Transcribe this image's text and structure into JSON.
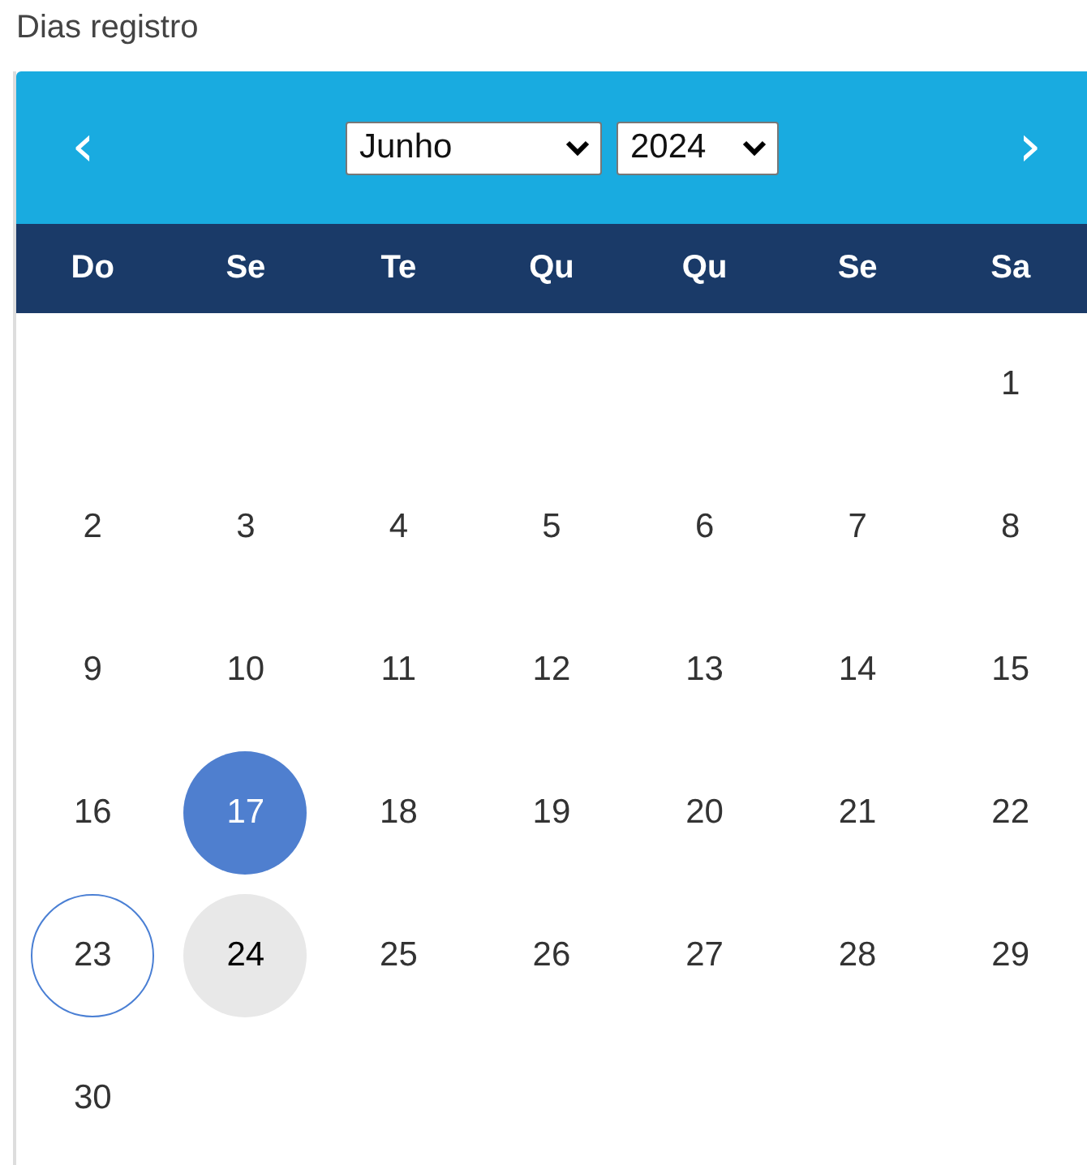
{
  "label": "Dias registro",
  "header": {
    "prev": "‹",
    "next": "›",
    "month": "Junho",
    "year": "2024"
  },
  "weekdays": [
    "Do",
    "Se",
    "Te",
    "Qu",
    "Qu",
    "Se",
    "Sa"
  ],
  "weeks": [
    {
      "days": [
        {
          "day": "1",
          "selected": false,
          "today": false,
          "highlighted": false
        }
      ]
    },
    {
      "days": [
        {
          "day": "2",
          "selected": false,
          "today": false,
          "highlighted": false
        },
        {
          "day": "3",
          "selected": false,
          "today": false,
          "highlighted": false
        },
        {
          "day": "4",
          "selected": false,
          "today": false,
          "highlighted": false
        },
        {
          "day": "5",
          "selected": false,
          "today": false,
          "highlighted": false
        },
        {
          "day": "6",
          "selected": false,
          "today": false,
          "highlighted": false
        },
        {
          "day": "7",
          "selected": false,
          "today": false,
          "highlighted": false
        },
        {
          "day": "8",
          "selected": false,
          "today": false,
          "highlighted": false
        }
      ]
    },
    {
      "days": [
        {
          "day": "9",
          "selected": false,
          "today": false,
          "highlighted": false
        },
        {
          "day": "10",
          "selected": false,
          "today": false,
          "highlighted": false
        },
        {
          "day": "11",
          "selected": false,
          "today": false,
          "highlighted": false
        },
        {
          "day": "12",
          "selected": false,
          "today": false,
          "highlighted": false
        },
        {
          "day": "13",
          "selected": false,
          "today": false,
          "highlighted": false
        },
        {
          "day": "14",
          "selected": false,
          "today": false,
          "highlighted": false
        },
        {
          "day": "15",
          "selected": false,
          "today": false,
          "highlighted": false
        }
      ]
    },
    {
      "days": [
        {
          "day": "16",
          "selected": false,
          "today": false,
          "highlighted": false
        },
        {
          "day": "17",
          "selected": true,
          "today": false,
          "highlighted": false
        },
        {
          "day": "18",
          "selected": false,
          "today": false,
          "highlighted": false
        },
        {
          "day": "19",
          "selected": false,
          "today": false,
          "highlighted": false
        },
        {
          "day": "20",
          "selected": false,
          "today": false,
          "highlighted": false
        },
        {
          "day": "21",
          "selected": false,
          "today": false,
          "highlighted": false
        },
        {
          "day": "22",
          "selected": false,
          "today": false,
          "highlighted": false
        }
      ]
    },
    {
      "days": [
        {
          "day": "23",
          "selected": false,
          "today": true,
          "highlighted": false
        },
        {
          "day": "24",
          "selected": false,
          "today": false,
          "highlighted": true
        },
        {
          "day": "25",
          "selected": false,
          "today": false,
          "highlighted": false
        },
        {
          "day": "26",
          "selected": false,
          "today": false,
          "highlighted": false
        },
        {
          "day": "27",
          "selected": false,
          "today": false,
          "highlighted": false
        },
        {
          "day": "28",
          "selected": false,
          "today": false,
          "highlighted": false
        },
        {
          "day": "29",
          "selected": false,
          "today": false,
          "highlighted": false
        }
      ]
    },
    {
      "days": [
        {
          "day": "30",
          "selected": false,
          "today": false,
          "highlighted": false
        }
      ]
    }
  ]
}
